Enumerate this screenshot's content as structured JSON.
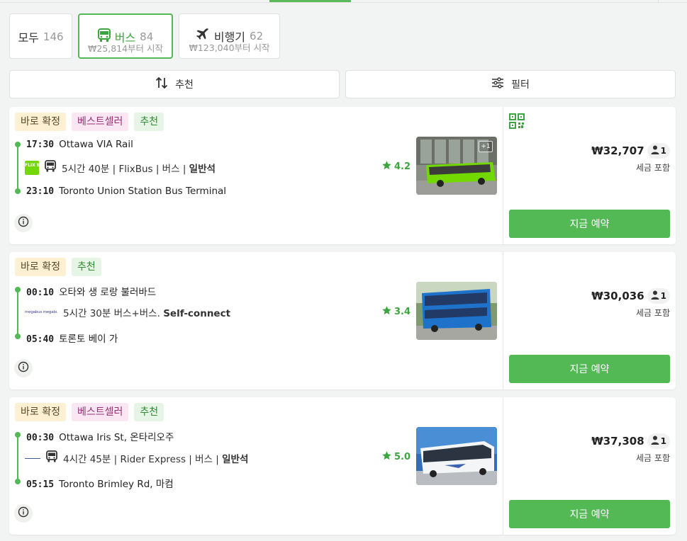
{
  "mode_tabs": [
    {
      "label": "모두",
      "count": "146",
      "sub": ""
    },
    {
      "label": "버스",
      "count": "84",
      "sub": "₩25,814부터 시작"
    },
    {
      "label": "비행기",
      "count": "62",
      "sub": "₩123,040부터 시작"
    }
  ],
  "controls": {
    "sort_label": "추천",
    "filter_label": "필터"
  },
  "colors": {
    "brand_green": "#53b955",
    "rating_green": "#3da53f"
  },
  "results": [
    {
      "badges": [
        "바로 확정",
        "베스트셀러",
        "추천"
      ],
      "departure_time": "17:30",
      "departure_place": "Ottawa VIA Rail",
      "carrier_logo": "FLIX BUS",
      "duration_text": "5시간 40분 | FlixBus | 버스 | ",
      "seat_class": "일반석",
      "arrival_time": "23:10",
      "arrival_place": "Toronto Union Station Bus Terminal",
      "rating": "4.2",
      "photo_count": "+1",
      "price": "₩32,707",
      "passengers": "1",
      "tax_note": "세금 포함",
      "book_label": "지금 예약"
    },
    {
      "badges": [
        "바로 확정",
        "추천"
      ],
      "departure_time": "00:10",
      "departure_place": "오타와 생 로랑 불러바드",
      "carrier_logo": "megabus megabus",
      "duration_text": "5시간 30분 버스+버스. ",
      "seat_class": "Self-connect",
      "arrival_time": "05:40",
      "arrival_place": "토론토 베이 가",
      "rating": "3.4",
      "price": "₩30,036",
      "passengers": "1",
      "tax_note": "세금 포함",
      "book_label": "지금 예약"
    },
    {
      "badges": [
        "바로 확정",
        "베스트셀러",
        "추천"
      ],
      "departure_time": "00:30",
      "departure_place": "Ottawa Iris St, 온타리오주",
      "carrier_logo": "",
      "duration_text": "4시간 45분 | Rider Express | 버스 | ",
      "seat_class": "일반석",
      "arrival_time": "05:15",
      "arrival_place": "Toronto Brimley Rd, 마컴",
      "rating": "5.0",
      "price": "₩37,308",
      "passengers": "1",
      "tax_note": "세금 포함",
      "book_label": "지금 예약"
    }
  ]
}
